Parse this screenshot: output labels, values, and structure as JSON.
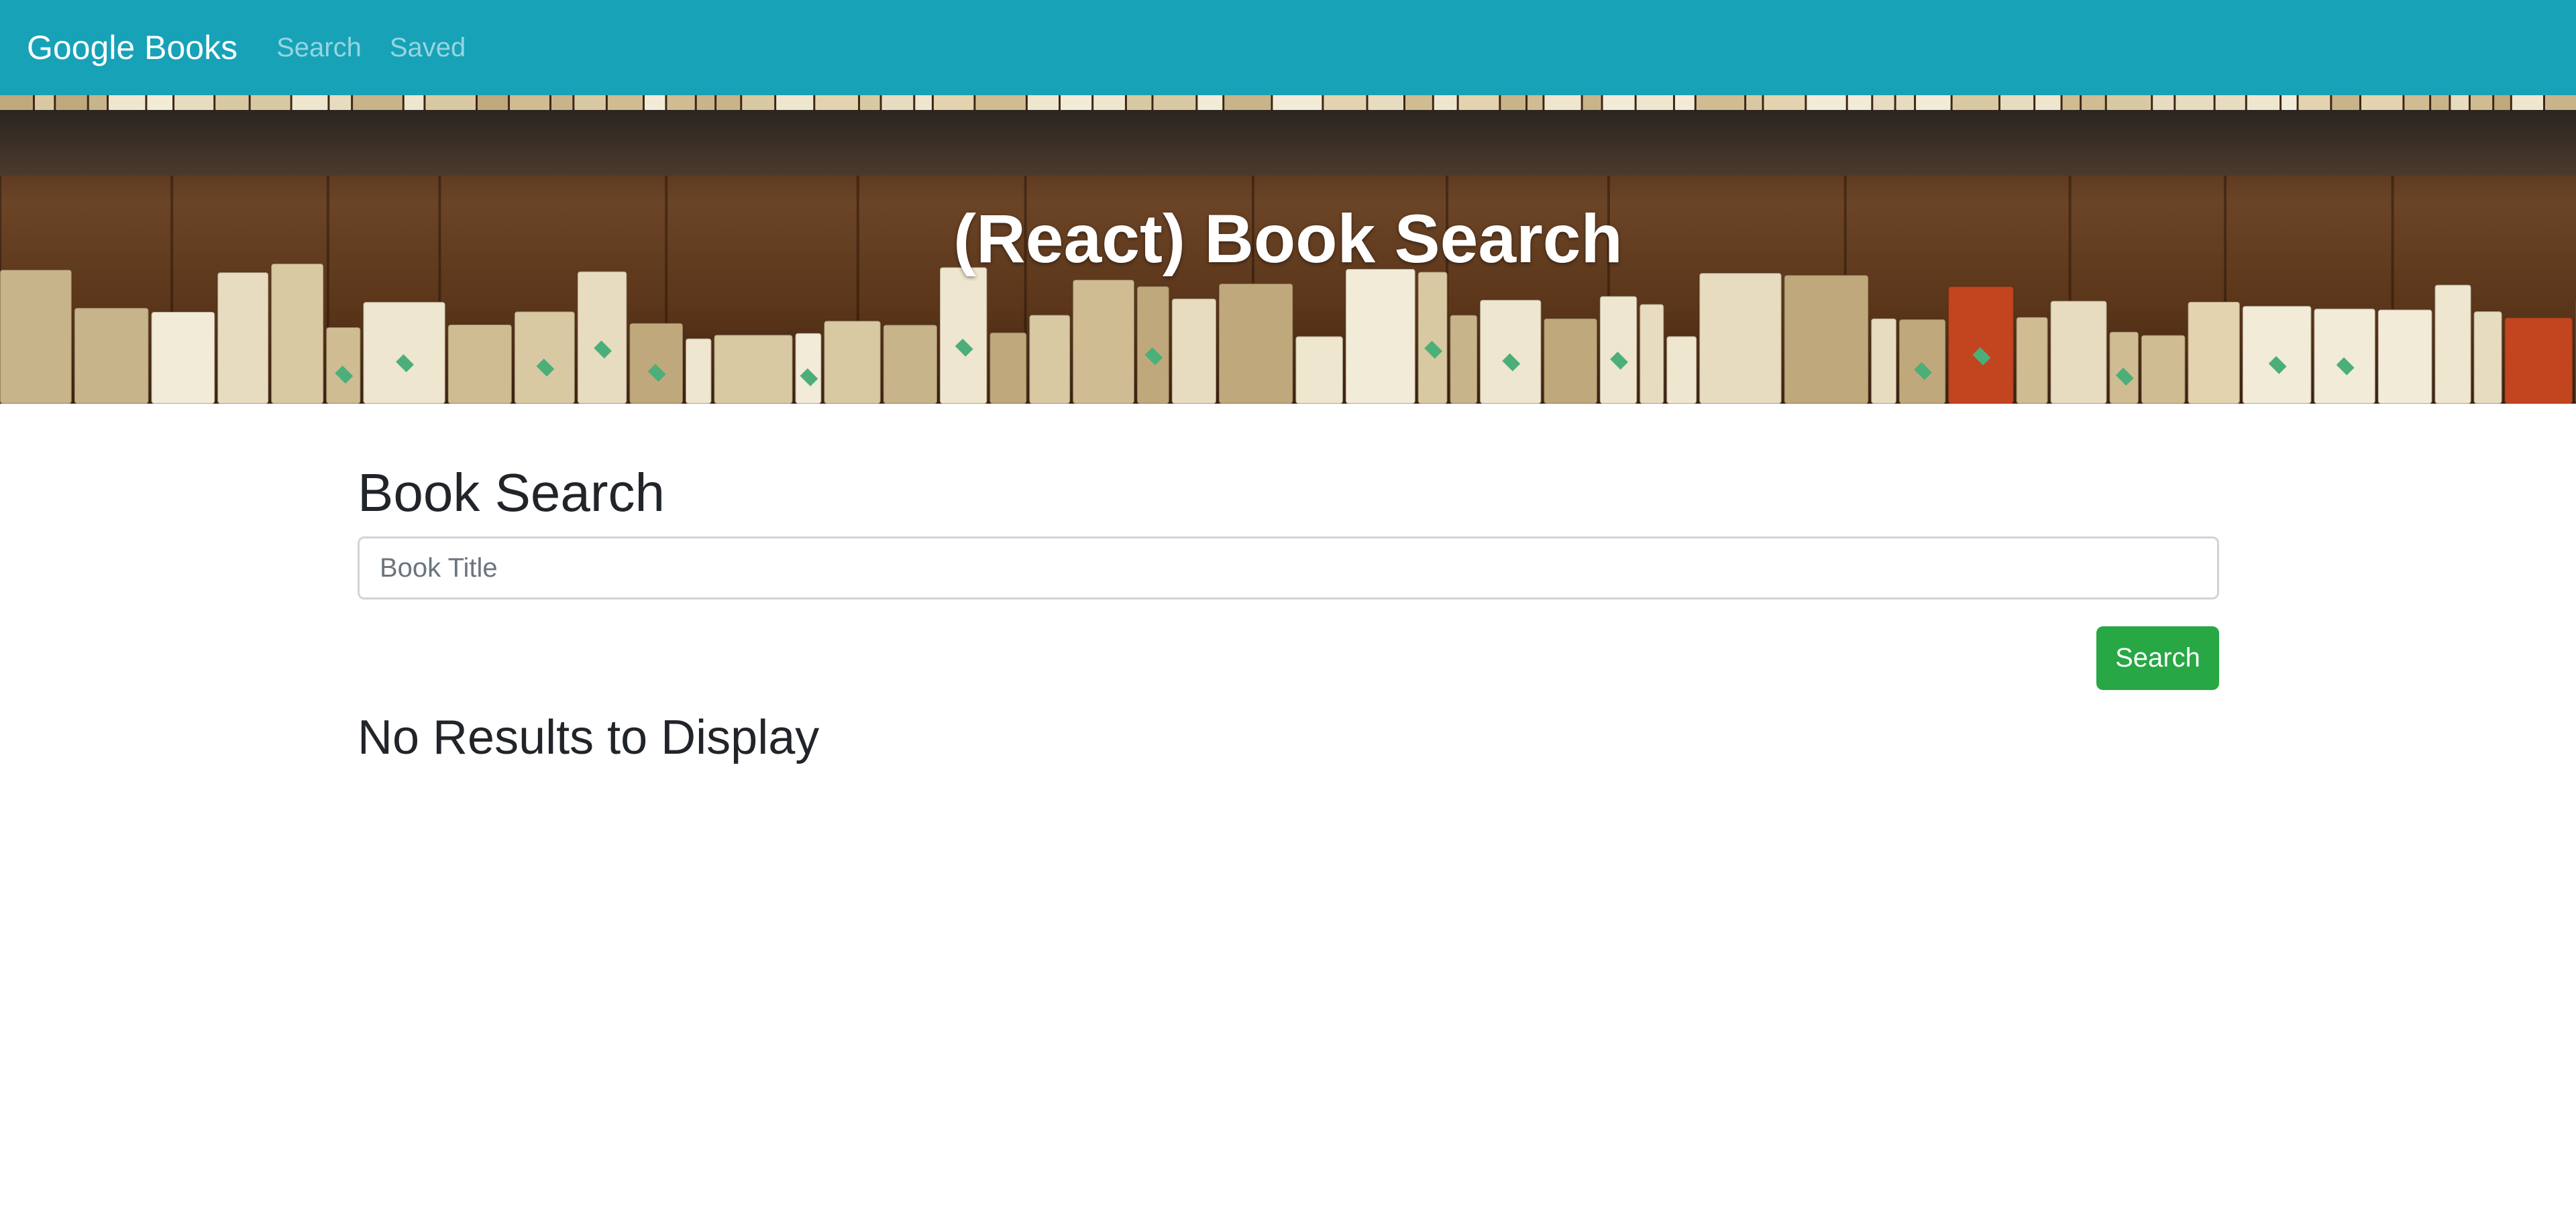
{
  "navbar": {
    "brand": "Google Books",
    "links": [
      {
        "label": "Search"
      },
      {
        "label": "Saved"
      }
    ],
    "background_color": "#17a2b8"
  },
  "hero": {
    "title": "(React) Book Search",
    "background": "bookshelf-photo"
  },
  "search": {
    "heading": "Book Search",
    "input_value": "",
    "placeholder": "Book Title",
    "button_label": "Search",
    "button_color": "#28a745"
  },
  "results": {
    "message": "No Results to Display"
  }
}
